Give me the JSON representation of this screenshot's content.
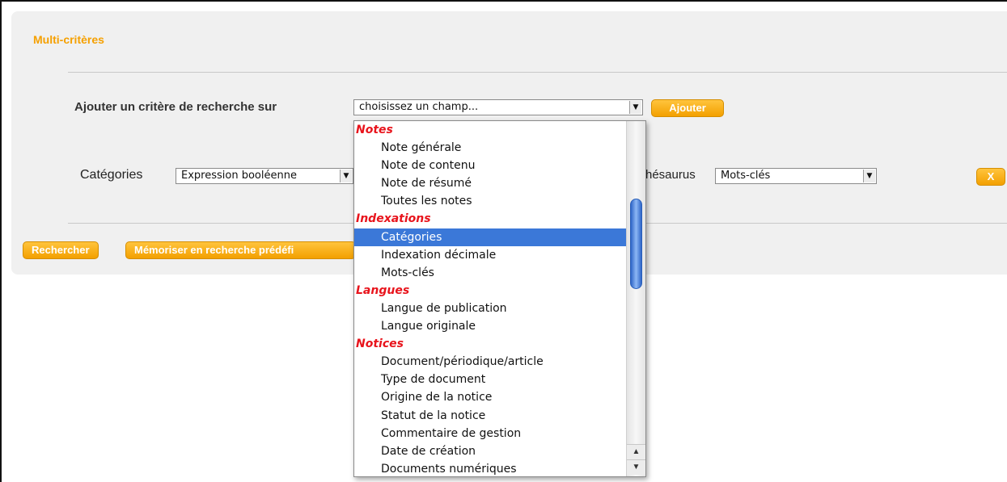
{
  "panel": {
    "title": "Multi-critères"
  },
  "add_criterion": {
    "label": "Ajouter un critère de recherche sur",
    "field_select": {
      "value": "choisissez un champ..."
    },
    "add_button": "Ajouter"
  },
  "criterion": {
    "label": "Catégories",
    "operator_select": {
      "value": "Expression booléenne"
    },
    "thesaurus_label": "hésaurus",
    "thesaurus_select": {
      "value": "Mots-clés"
    },
    "remove_button": "X"
  },
  "actions": {
    "search_button": "Rechercher",
    "memorize_button": "Mémoriser en recherche prédéfi"
  },
  "dropdown": {
    "groups": [
      {
        "label": "Notes",
        "items": [
          "Note générale",
          "Note de contenu",
          "Note de résumé",
          "Toutes les notes"
        ]
      },
      {
        "label": "Indexations",
        "items": [
          "Catégories",
          "Indexation décimale",
          "Mots-clés"
        ]
      },
      {
        "label": "Langues",
        "items": [
          "Langue de publication",
          "Langue originale"
        ]
      },
      {
        "label": "Notices",
        "items": [
          "Document/périodique/article",
          "Type de document",
          "Origine de la notice",
          "Statut de la notice",
          "Commentaire de gestion",
          "Date de création",
          "Documents numériques"
        ]
      }
    ],
    "selected_item": "Catégories",
    "scroll_up_icon": "triangle-up-icon",
    "scroll_down_icon": "triangle-down-icon"
  },
  "colors": {
    "accent": "#f5a000",
    "group_label": "#e8141c",
    "selection": "#3b78d8"
  }
}
